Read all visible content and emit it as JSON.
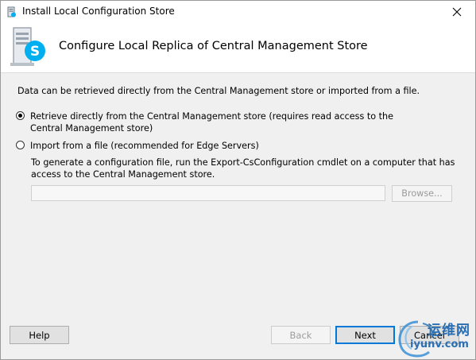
{
  "window": {
    "title": "Install Local Configuration Store",
    "close_icon": "close-icon"
  },
  "header": {
    "title": "Configure Local Replica of Central Management Store",
    "icon": "skype-server-icon"
  },
  "content": {
    "description": "Data can be retrieved directly from the Central Management store or imported from a file.",
    "options": [
      {
        "label": "Retrieve directly from the Central Management store (requires read access to the Central Management store)",
        "selected": true
      },
      {
        "label": "Import from a file (recommended for Edge Servers)",
        "selected": false
      }
    ],
    "import_help": "To generate a configuration file, run the Export-CsConfiguration cmdlet on a computer that has access to the Central Management store.",
    "file_path_value": "",
    "browse_label": "Browse..."
  },
  "footer": {
    "help_label": "Help",
    "back_label": "Back",
    "next_label": "Next",
    "cancel_label": "Cancel"
  },
  "watermark": {
    "cn_text": "运维网",
    "domain": "iyunv.com"
  },
  "colors": {
    "accent": "#0078d7",
    "skype_blue": "#00aff0",
    "watermark_blue": "#2b6fb2"
  }
}
